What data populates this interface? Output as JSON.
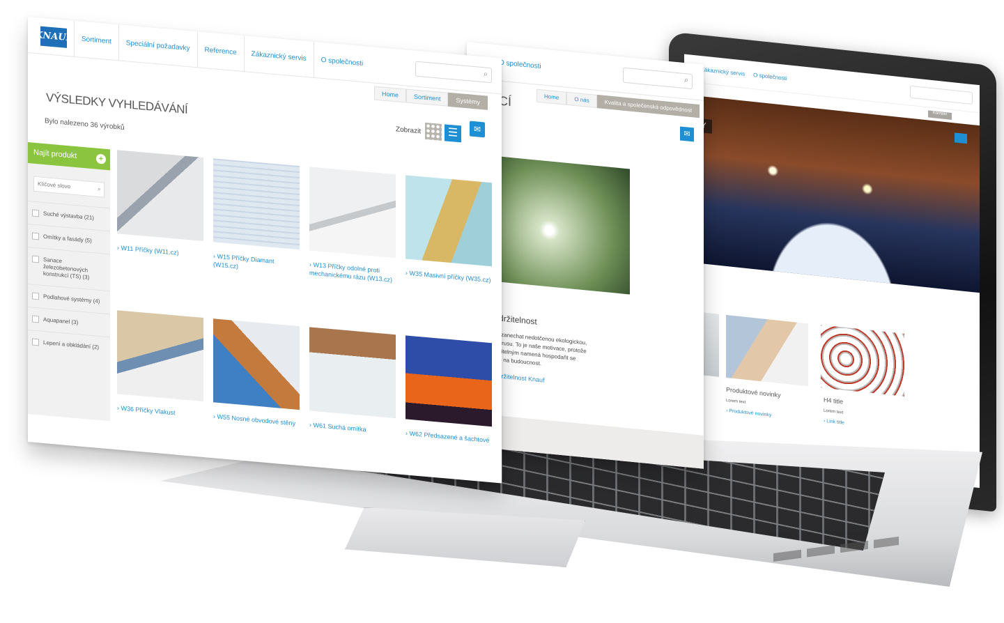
{
  "front_page": {
    "logo": "KNAUF",
    "nav": [
      "Sortiment",
      "Speciální požadavky",
      "Reference",
      "Zákaznický servis",
      "O společnosti"
    ],
    "breadcrumbs": [
      "Home",
      "Sortiment",
      "Systémy"
    ],
    "title": "VÝSLEDKY VYHLEDÁVÁNÍ",
    "result_count": "Bylo nalezeno 36 výrobků",
    "view_label": "Zobrazit",
    "filter": {
      "heading": "Najít produkt",
      "search_placeholder": "Klíčové slovo",
      "options": [
        "Suché výstavba (21)",
        "Omítky a fasády (5)",
        "Sanace železobetonových konstrukcí (TS) (3)",
        "Podlahové systémy (4)",
        "Aquapanel (3)",
        "Lepení a obkládání (2)"
      ]
    },
    "products": [
      "› W11 Příčky (W11.cz)",
      "› W15 Příčky Diamant (W15.cz)",
      "› W13 Příčky odolné proti mechanickému rázu (W13.cz)",
      "› W35 Masivní příčky (W35.cz)",
      "› W36 Příčky Vlakust",
      "› W55 Nosné obvodové stěny",
      "› W61 Suchá omítka",
      "› W62 Předsazené a šachtové"
    ]
  },
  "middle_page": {
    "nav_label": "O společnosti",
    "breadcrumbs": [
      "Home",
      "O nás",
      "Kvalita a společenská odpovědnost"
    ],
    "title": "AJÍCÍ",
    "heading": "ost a udržitelnost",
    "text": "m maxime zanechat nedotčenou ekologickou, sociální a zrusu. To je naše motivace, protože jednat udržitelným namená hospodařit se zaměřením na budoucnost.",
    "link": "tnost a udržitelnost Knauf"
  },
  "laptop_screen": {
    "nav": [
      "Zákaznický servis",
      "O společnosti"
    ],
    "button": "Kontakt",
    "hero_label": "ORY",
    "news_heading": "Produktové novinky",
    "news_small": "Lorem text",
    "news_link": "› Produktové novinky",
    "h4_heading": "H4 title",
    "h4_small": "Lorem text",
    "h4_link": "› Link title"
  }
}
